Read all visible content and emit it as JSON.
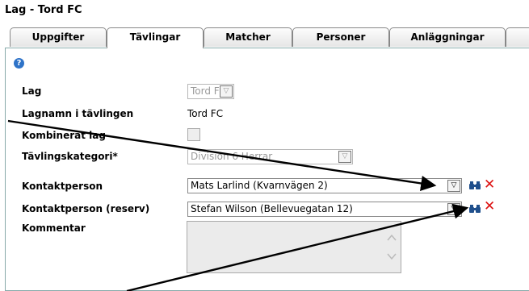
{
  "page": {
    "title": "Lag - Tord FC"
  },
  "tabs": [
    {
      "label": "Uppgifter"
    },
    {
      "label": "Tävlingar"
    },
    {
      "label": "Matcher"
    },
    {
      "label": "Personer"
    },
    {
      "label": "Anläggningar"
    }
  ],
  "help": {
    "icon": "?"
  },
  "form": {
    "lag_label": "Lag",
    "lag_value": "Tord FC",
    "lagnamn_label": "Lagnamn i tävlingen",
    "lagnamn_value": "Tord FC",
    "kombinerat_label": "Kombinerat lag",
    "kategori_label": "Tävlingskategori*",
    "kategori_value": "Division 6 Herrar",
    "kontakt_label": "Kontaktperson",
    "kontakt_value": "Mats Larlind (Kvarnvägen 2)",
    "kontakt_reserv_label": "Kontaktperson (reserv)",
    "kontakt_reserv_value": "Stefan Wilson (Bellevuegatan 12)",
    "kommentar_label": "Kommentar",
    "kommentar_value": ""
  },
  "icons": {
    "select_arrow": "▽",
    "delete": "✕",
    "scroll_up": "︿",
    "scroll_down": "﹀"
  },
  "colors": {
    "delete": "#dd1111",
    "help": "#2e73c8",
    "binoculars": "#1f4f8c"
  }
}
